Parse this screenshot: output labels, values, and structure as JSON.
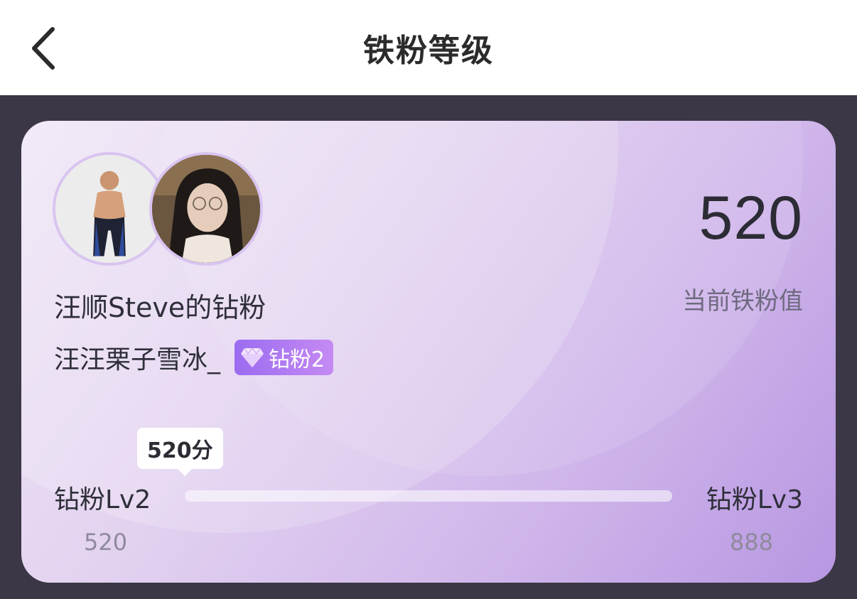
{
  "header": {
    "title": "铁粉等级",
    "back_icon": "chevron-left-icon"
  },
  "card": {
    "title": "汪顺Steve的钻粉",
    "user_name": "汪汪栗子雪冰_",
    "badge": {
      "icon": "diamond-icon",
      "label": "钻粉2"
    },
    "score": "520",
    "score_label": "当前铁粉值",
    "progress": {
      "tooltip": "520分",
      "current_level": "钻粉Lv2",
      "next_level": "钻粉Lv3",
      "current_threshold": "520",
      "next_threshold": "888",
      "fraction": 0.0
    },
    "avatars": [
      {
        "icon": "avatar-icon"
      },
      {
        "icon": "avatar-icon"
      }
    ]
  },
  "colors": {
    "card_gradient_start": "#efe6f6",
    "card_gradient_end": "#b797e2",
    "badge_gradient_start": "#9b6cf0",
    "badge_gradient_end": "#c58af3",
    "page_bg": "#3b3746"
  }
}
